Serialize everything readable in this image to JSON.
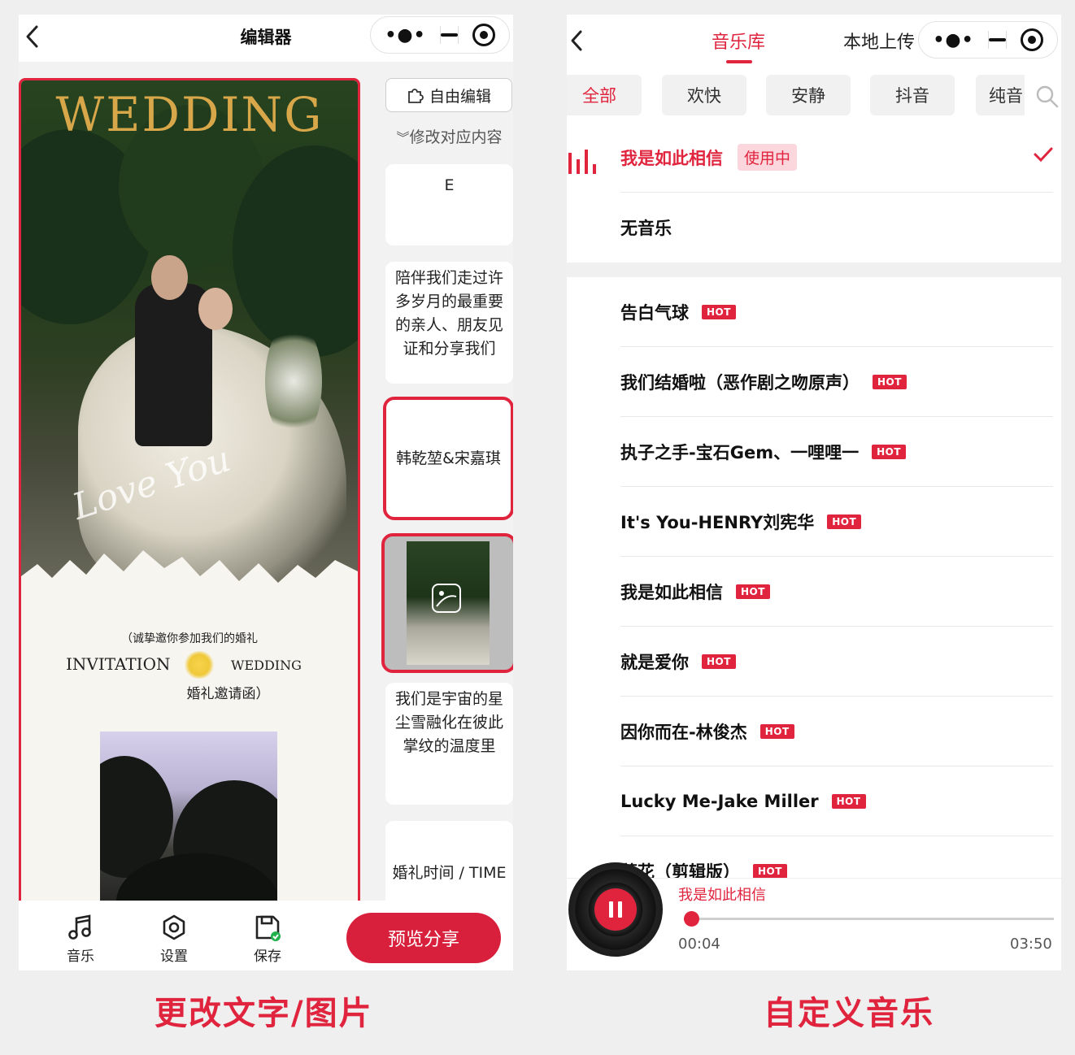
{
  "left": {
    "nav_title": "编辑器",
    "side": {
      "free_edit_label": "自由编辑",
      "modify_hint": "修改对应内容",
      "thumbs": [
        "E",
        "陪伴我们走过许多岁月的最重要的亲人、朋友见证和分享我们",
        "韩乾堃&宋嘉琪",
        "我们是宇宙的星尘雪融化在彼此掌纹的温度里",
        "婚礼时间 / TIME"
      ]
    },
    "preview": {
      "wedding_title": "WEDDING",
      "love_script": "Love You",
      "invite_small": "（诚挚邀你参加我们的婚礼",
      "invite_left": "INVITATION",
      "invite_right": "WEDDING",
      "invite_cn": "婚礼邀请函）"
    },
    "bottom": {
      "music": "音乐",
      "settings": "设置",
      "save": "保存",
      "preview_share": "预览分享"
    }
  },
  "right": {
    "tabs": {
      "library": "音乐库",
      "local_upload": "本地上传"
    },
    "chips": [
      "全部",
      "欢快",
      "安静",
      "抖音",
      "纯音"
    ],
    "current": {
      "title": "我是如此相信",
      "badge": "使用中"
    },
    "no_music": "无音乐",
    "hot_label": "HOT",
    "songs": [
      "告白气球",
      "我们结婚啦（恶作剧之吻原声）",
      "执子之手-宝石Gem、一哩哩一",
      "It's You-HENRY刘宪华",
      "我是如此相信",
      "就是爱你",
      "因你而在-林俊杰",
      "Lucky Me-Jake Miller",
      "落花（剪辑版）"
    ],
    "player": {
      "now_playing": "我是如此相信",
      "current_time": "00:04",
      "total_time": "03:50",
      "progress": 0.02
    }
  },
  "captions": {
    "left": "更改文字/图片",
    "right": "自定义音乐"
  },
  "colors": {
    "accent": "#e0243e",
    "gold": "#d8a74a"
  }
}
